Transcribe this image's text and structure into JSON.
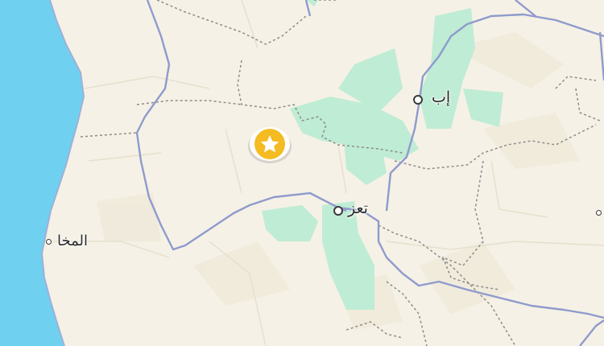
{
  "map": {
    "colors": {
      "sea": "#6fd0f0",
      "land": "#f5f1e6",
      "vegetation": "#bfecd4",
      "border": "#8f9bcc",
      "district_border": "#8a8a8a",
      "marker": "#f4bb22"
    },
    "cities": [
      {
        "id": "ibb",
        "name": "إب"
      },
      {
        "id": "taiz",
        "name": "تعز"
      },
      {
        "id": "mokha",
        "name": "المخا"
      }
    ],
    "marker": {
      "icon": "star-icon"
    }
  }
}
